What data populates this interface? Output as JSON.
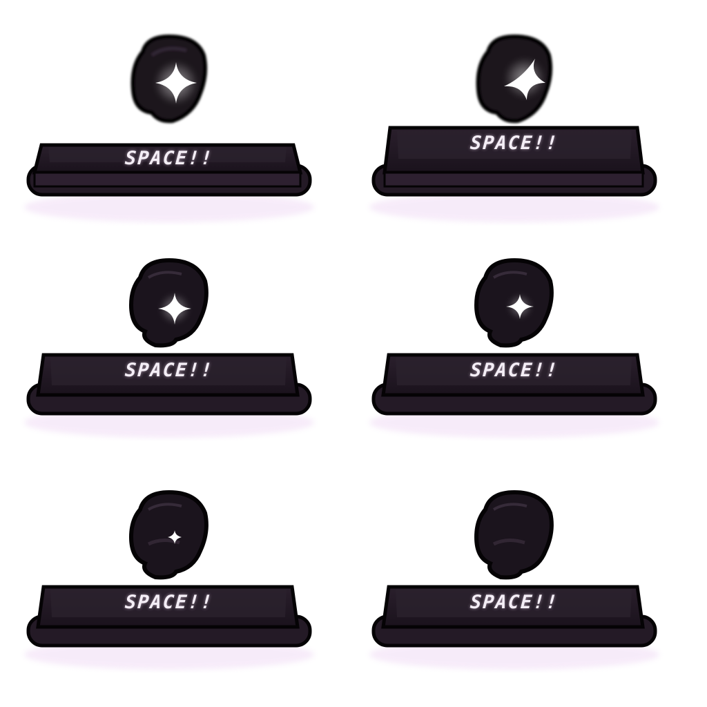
{
  "sheet": {
    "background": "#ffffff",
    "colors": {
      "key_body": "#1a131b",
      "key_glow": "#a050c0",
      "orb_body": "#1b141d",
      "sparkle": "#ffffff",
      "label": "#f4eef6"
    },
    "frames": [
      {
        "label": "SPACE!!",
        "pressed": true,
        "sparkle": "sparkle-large"
      },
      {
        "label": "SPACE!!",
        "pressed": false,
        "sparkle": "sparkle-large"
      },
      {
        "label": "SPACE!!",
        "pressed": false,
        "sparkle": "sparkle-medium"
      },
      {
        "label": "SPACE!!",
        "pressed": false,
        "sparkle": "sparkle-medium"
      },
      {
        "label": "SPACE!!",
        "pressed": false,
        "sparkle": "sparkle-small"
      },
      {
        "label": "SPACE!!",
        "pressed": false,
        "sparkle": "none"
      }
    ]
  }
}
